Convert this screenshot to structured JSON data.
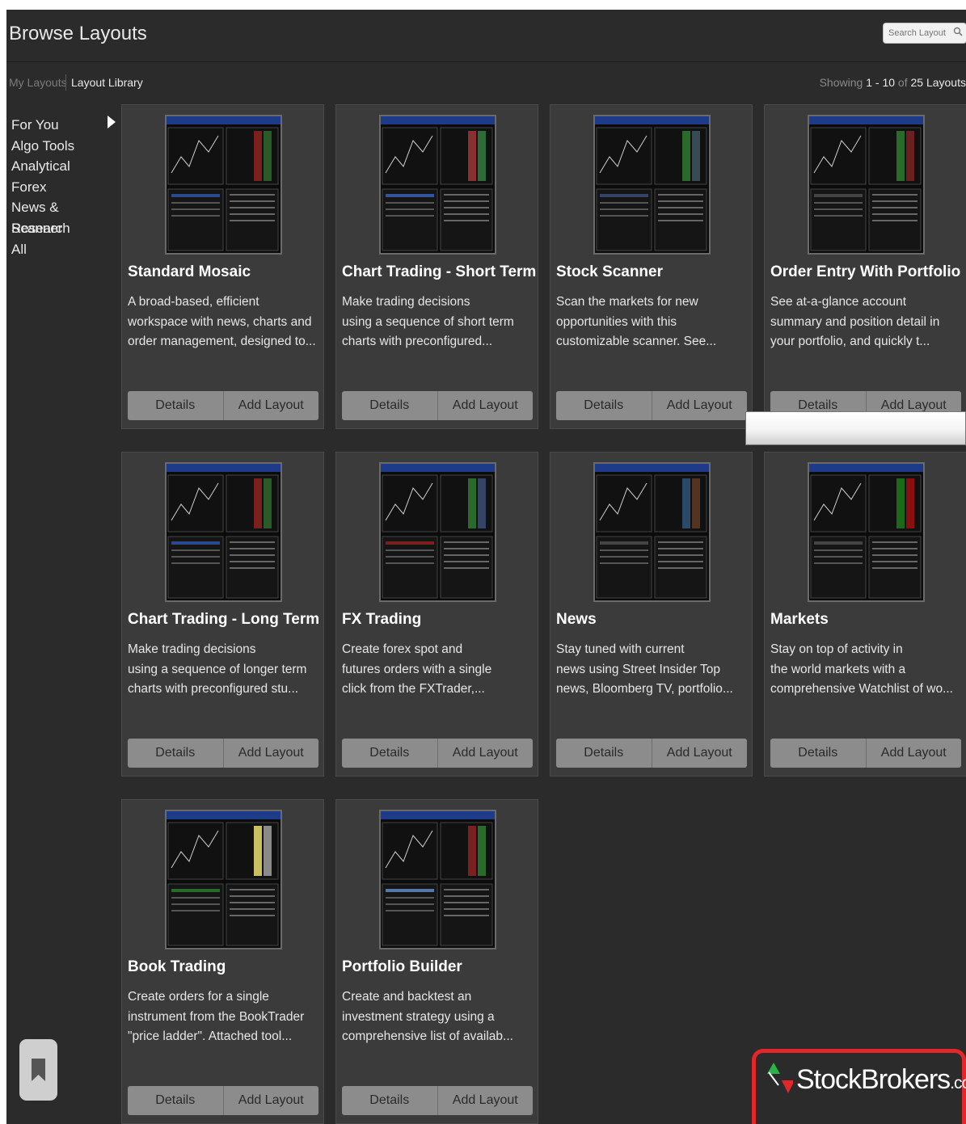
{
  "window": {
    "title": "Browse Layouts"
  },
  "search": {
    "placeholder": "Search Layout"
  },
  "tabs": {
    "my_layouts": "My Layouts",
    "layout_library": "Layout Library"
  },
  "showing": {
    "prefix": "Showing",
    "from": "1",
    "dash": "-",
    "to": "10",
    "of": "of",
    "total": "25",
    "unit": "Layouts"
  },
  "sidebar": {
    "items": [
      "For You",
      "Algo Tools",
      "Analytical",
      "Forex",
      "News & Research",
      "Scanner",
      "All"
    ]
  },
  "buttons": {
    "details": "Details",
    "add": "Add Layout"
  },
  "cards": [
    {
      "title": "Standard Mosaic",
      "desc": [
        "A broad-based, efficient",
        "workspace with news, charts and",
        "order management, designed to..."
      ]
    },
    {
      "title": "Chart Trading - Short Term",
      "desc": [
        "Make trading decisions",
        "using a sequence of short term",
        "charts with preconfigured..."
      ]
    },
    {
      "title": "Stock Scanner",
      "desc": [
        "Scan the markets for new",
        "opportunities with this",
        "customizable scanner. See..."
      ]
    },
    {
      "title": "Order Entry With Portfolio",
      "desc": [
        "See at-a-glance account",
        "summary and position detail in",
        "your portfolio, and quickly t..."
      ]
    },
    {
      "title": "Chart Trading - Long Term",
      "desc": [
        "Make trading decisions",
        "using a sequence of longer term",
        "charts with preconfigured stu..."
      ]
    },
    {
      "title": "FX Trading",
      "desc": [
        "Create forex spot and",
        "futures orders with a single",
        "click from the FXTrader,..."
      ]
    },
    {
      "title": "News",
      "desc": [
        "Stay tuned with current",
        "news using Street Insider Top",
        "news, Bloomberg TV, portfolio..."
      ]
    },
    {
      "title": "Markets",
      "desc": [
        "Stay on top of activity in",
        "the world markets with a",
        "comprehensive Watchlist of wo..."
      ]
    },
    {
      "title": "Book Trading",
      "desc": [
        "Create orders for a single",
        "instrument from the BookTrader",
        "\"price ladder\". Attached tool..."
      ]
    },
    {
      "title": "Portfolio Builder",
      "desc": [
        "Create and backtest an",
        "investment strategy using a",
        "comprehensive list of availab..."
      ]
    }
  ],
  "brand": {
    "name": "StockBrokers",
    "suffix": ".com"
  },
  "colors": {
    "background": "#2b2b2b",
    "card": "#3b3b3b",
    "button": "#8c8c8c",
    "brand_red": "#e3262a"
  }
}
